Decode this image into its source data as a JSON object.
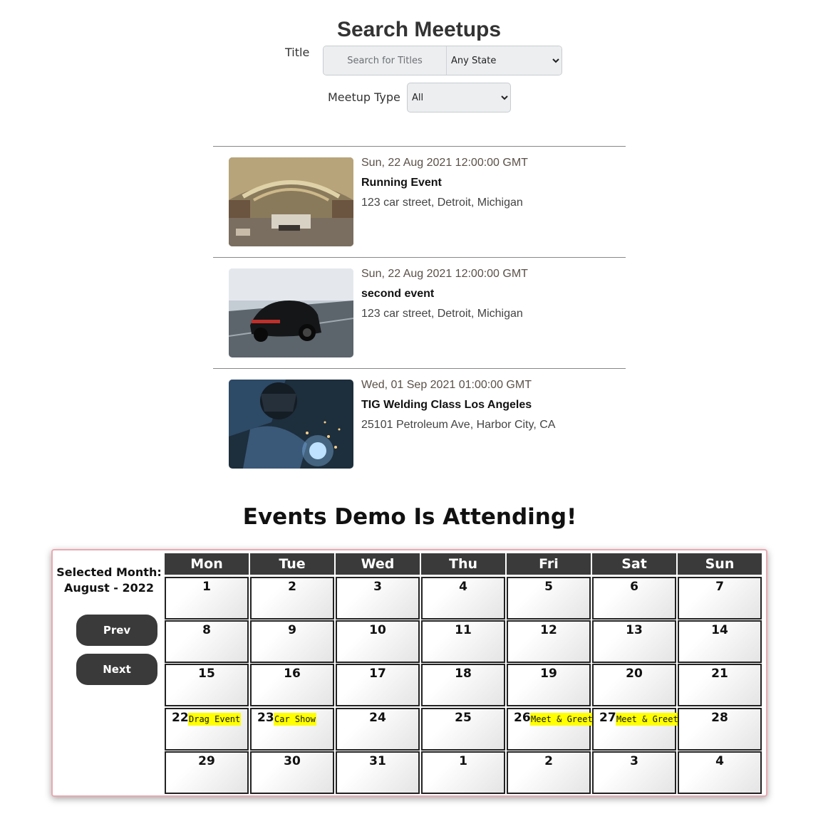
{
  "search": {
    "heading": "Search Meetups",
    "title_label": "Title",
    "title_placeholder": "Search for Titles",
    "state_selected": "Any State",
    "type_label": "Meetup Type",
    "type_selected": "All"
  },
  "events": [
    {
      "date": "Sun, 22 Aug 2021 12:00:00 GMT",
      "title": "Running Event",
      "address": "123 car street, Detroit, Michigan",
      "image_icon": "abandoned-theater-image"
    },
    {
      "date": "Sun, 22 Aug 2021 12:00:00 GMT",
      "title": "second event",
      "address": "123 car street, Detroit, Michigan",
      "image_icon": "black-car-image"
    },
    {
      "date": "Wed, 01 Sep 2021 01:00:00 GMT",
      "title": "TIG Welding Class Los Angeles",
      "address": "25101 Petroleum Ave, Harbor City, CA",
      "image_icon": "welder-image"
    }
  ],
  "calendar": {
    "heading": "Events Demo Is Attending!",
    "selected_month_label": "Selected Month:",
    "selected_month_value": "August - 2022",
    "prev_label": "Prev",
    "next_label": "Next",
    "weekdays": [
      "Mon",
      "Tue",
      "Wed",
      "Thu",
      "Fri",
      "Sat",
      "Sun"
    ],
    "days": [
      {
        "n": "1"
      },
      {
        "n": "2"
      },
      {
        "n": "3"
      },
      {
        "n": "4"
      },
      {
        "n": "5"
      },
      {
        "n": "6"
      },
      {
        "n": "7"
      },
      {
        "n": "8"
      },
      {
        "n": "9"
      },
      {
        "n": "10"
      },
      {
        "n": "11"
      },
      {
        "n": "12"
      },
      {
        "n": "13"
      },
      {
        "n": "14"
      },
      {
        "n": "15"
      },
      {
        "n": "16"
      },
      {
        "n": "17"
      },
      {
        "n": "18"
      },
      {
        "n": "19"
      },
      {
        "n": "20"
      },
      {
        "n": "21"
      },
      {
        "n": "22",
        "event": "Drag Event"
      },
      {
        "n": "23",
        "event": "Car Show"
      },
      {
        "n": "24"
      },
      {
        "n": "25"
      },
      {
        "n": "26",
        "event": "Meet & Greet"
      },
      {
        "n": "27",
        "event": "Meet & Greet"
      },
      {
        "n": "28"
      },
      {
        "n": "29"
      },
      {
        "n": "30"
      },
      {
        "n": "31"
      },
      {
        "n": "1"
      },
      {
        "n": "2"
      },
      {
        "n": "3"
      },
      {
        "n": "4"
      }
    ],
    "highlight_color": "#ffff00",
    "header_color": "#3a3a3a"
  }
}
